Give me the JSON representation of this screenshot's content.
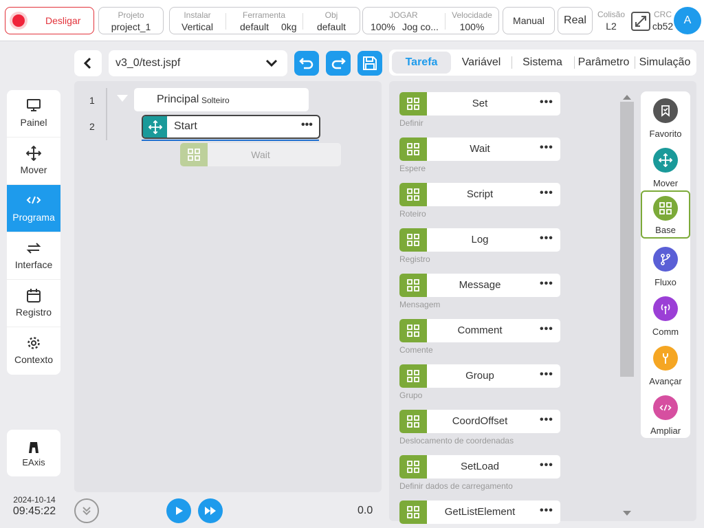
{
  "topbar": {
    "power_label": "Desligar",
    "project": {
      "label": "Projeto",
      "value": "project_1"
    },
    "install": {
      "label": "Instalar",
      "value": "Vertical"
    },
    "tool": {
      "label": "Ferramenta",
      "value": "default",
      "load": "0kg"
    },
    "obj": {
      "label": "Obj",
      "value": "default"
    },
    "jog": {
      "label": "JOGAR",
      "percent": "100%",
      "mode": "Jog co..."
    },
    "speed": {
      "label": "Velocidade",
      "value": "100%"
    },
    "manual_label": "Manual",
    "real_label": "Real",
    "collision": {
      "label": "Colisão",
      "value": "L2"
    },
    "crc": {
      "label": "CRC",
      "value": "cb52"
    },
    "avatar_letter": "A"
  },
  "nav": {
    "items": [
      {
        "label": "Painel",
        "icon": "monitor-icon"
      },
      {
        "label": "Mover",
        "icon": "move-icon"
      },
      {
        "label": "Programa",
        "icon": "code-icon"
      },
      {
        "label": "Interface",
        "icon": "swap-icon"
      },
      {
        "label": "Registro",
        "icon": "calendar-icon"
      },
      {
        "label": "Contexto",
        "icon": "gear-icon"
      }
    ],
    "active": "Programa",
    "eaxis_label": "EAxis"
  },
  "datetime": {
    "date": "2024-10-14",
    "time": "09:45:22"
  },
  "program": {
    "file": "v3_0/test.jspf",
    "lines": [
      {
        "number": "1",
        "name": "Principal",
        "tag": "Solteiro"
      },
      {
        "number": "2",
        "name": "Start"
      }
    ],
    "ghost_item": "Wait",
    "progress_value": "0.0"
  },
  "tabs": [
    "Tarefa",
    "Variável",
    "Sistema",
    "Parâmetro",
    "Simulação"
  ],
  "active_tab": "Tarefa",
  "tasks": [
    {
      "name": "Set",
      "desc": "Definir"
    },
    {
      "name": "Wait",
      "desc": "Espere"
    },
    {
      "name": "Script",
      "desc": "Roteiro"
    },
    {
      "name": "Log",
      "desc": "Registro"
    },
    {
      "name": "Message",
      "desc": "Mensagem"
    },
    {
      "name": "Comment",
      "desc": "Comente"
    },
    {
      "name": "Group",
      "desc": "Grupo"
    },
    {
      "name": "CoordOffset",
      "desc": "Deslocamento de coordenadas"
    },
    {
      "name": "SetLoad",
      "desc": "Definir dados de carregamento"
    },
    {
      "name": "GetListElement",
      "desc": ""
    }
  ],
  "categories": [
    {
      "label": "Favorito",
      "color": "#555555",
      "icon": "bookmark-icon"
    },
    {
      "label": "Mover",
      "color": "#1a9a9a",
      "icon": "move-icon"
    },
    {
      "label": "Base",
      "color": "#7caa39",
      "icon": "grid-icon"
    },
    {
      "label": "Fluxo",
      "color": "#5a5fd6",
      "icon": "branch-icon"
    },
    {
      "label": "Comm",
      "color": "#9b3fd6",
      "icon": "antenna-icon"
    },
    {
      "label": "Avançar",
      "color": "#f5a623",
      "icon": "wrench-icon"
    },
    {
      "label": "Ampliar",
      "color": "#d64fa0",
      "icon": "code-icon"
    }
  ],
  "active_category": "Base",
  "colors": {
    "accent": "#1e9bec",
    "danger": "#e2323a",
    "task_green": "#7caa39",
    "teal": "#1a9a9a"
  }
}
